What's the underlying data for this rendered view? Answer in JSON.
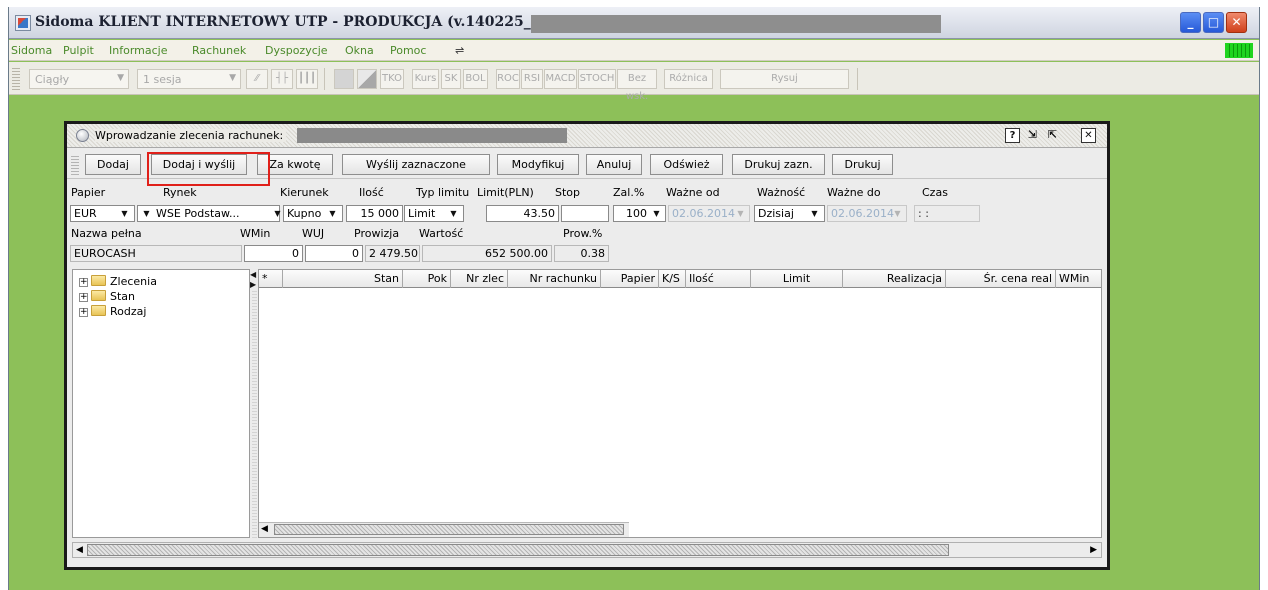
{
  "window": {
    "title": "Sidoma KLIENT INTERNETOWY UTP - PRODUKCJA (v.140225_08)",
    "controls": [
      "_",
      "□",
      "✕"
    ]
  },
  "menu": {
    "items": [
      "Sidoma",
      "Pulpit",
      "Informacje",
      "Rachunek",
      "Dyspozycje",
      "Okna",
      "Pomoc"
    ],
    "status_color": "#1fd41f"
  },
  "toolbar": {
    "mode": "Ciągły",
    "session": "1 sesja",
    "buttons": [
      "TKO",
      "Kurs",
      "SK",
      "BOL",
      "ROC",
      "RSI",
      "MACD",
      "STOCH",
      "Bez wsk.",
      "Różnica",
      "Rysuj"
    ]
  },
  "frame": {
    "title": "Wprowadzanie zlecenia rachunek:",
    "help": "?",
    "close": "✕",
    "buttons": {
      "add": "Dodaj",
      "add_send": "Dodaj i wyślij",
      "by_amount": "Za kwotę",
      "send_selected": "Wyślij zaznaczone",
      "modify": "Modyfikuj",
      "cancel": "Anuluj",
      "refresh": "Odśwież",
      "print_selected": "Drukuj zazn.",
      "print": "Drukuj"
    },
    "highlight_color": "#e0201a"
  },
  "form": {
    "labels": {
      "paper": "Papier",
      "market": "Rynek",
      "direction": "Kierunek",
      "quantity": "Ilość",
      "limit_type": "Typ limitu",
      "limit": "Limit(PLN)",
      "stop": "Stop",
      "deposit": "Zal.%",
      "valid_from": "Ważne od",
      "validity": "Ważność",
      "valid_to": "Ważne do",
      "time": "Czas",
      "full_name": "Nazwa pełna",
      "wmin": "WMin",
      "wuj": "WUJ",
      "commission": "Prowizja",
      "value": "Wartość",
      "commission_pct": "Prow.%"
    },
    "values": {
      "paper": "EUR",
      "market": "WSE Podstaw...",
      "direction": "Kupno",
      "quantity": "15 000",
      "limit_type": "Limit",
      "limit": "43.50",
      "stop": "",
      "deposit": "100",
      "valid_from": "02.06.2014",
      "validity": "Dzisiaj",
      "valid_to": "02.06.2014",
      "time": ": :",
      "full_name": "EUROCASH",
      "wmin": "0",
      "wuj": "0",
      "commission": "2 479.50",
      "value": "652 500.00",
      "commission_pct": "0.38"
    }
  },
  "tree": {
    "items": [
      "Zlecenia",
      "Stan",
      "Rodzaj"
    ]
  },
  "table": {
    "columns": [
      "*",
      "Stan",
      "Pok",
      "Nr zlec",
      "Nr rachunku",
      "Papier",
      "K/S",
      "Ilość",
      "Limit",
      "Realizacja",
      "Śr. cena real",
      "WMin"
    ],
    "rows": []
  }
}
